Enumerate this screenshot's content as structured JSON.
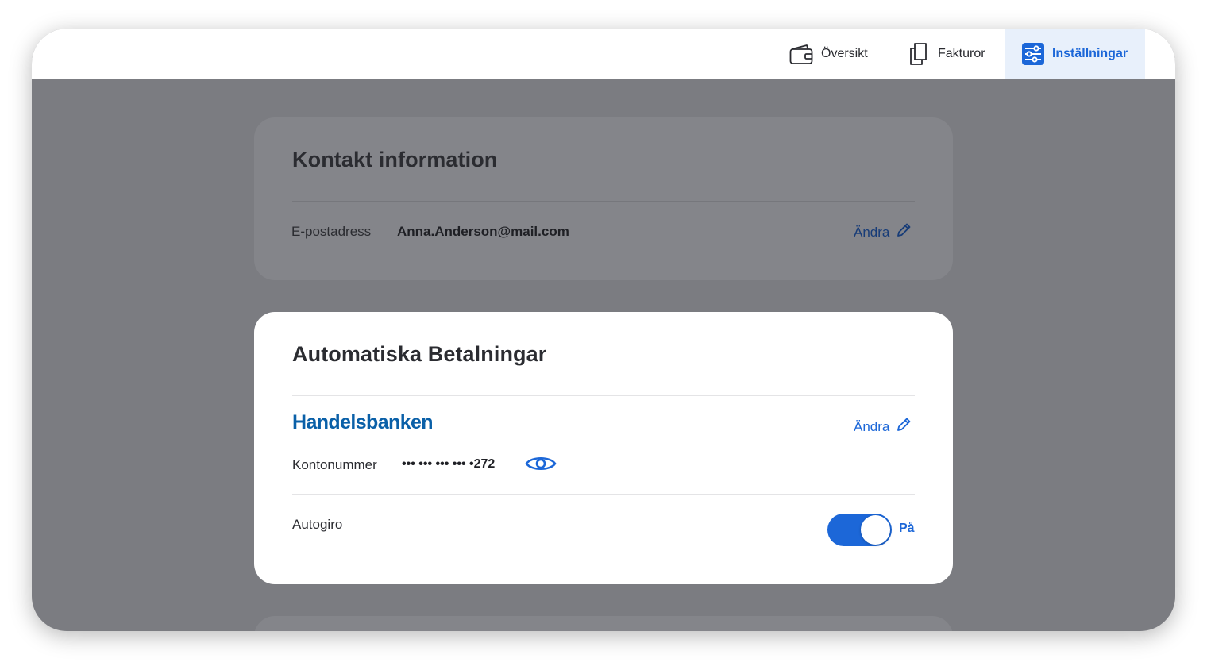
{
  "nav": {
    "overview_label": "Översikt",
    "invoices_label": "Fakturor",
    "settings_label": "Inställningar",
    "active": "settings"
  },
  "contact": {
    "title": "Kontakt information",
    "email_label": "E-postadress",
    "email_value": "Anna.Anderson@mail.com",
    "edit_label": "Ändra"
  },
  "autopay": {
    "title": "Automatiska Betalningar",
    "bank_name": "Handelsbanken",
    "edit_label": "Ändra",
    "account_label": "Kontonummer",
    "account_masked": "••• ••• ••• ••• •272",
    "autogiro_label": "Autogiro",
    "autogiro_state": "På",
    "autogiro_on": true
  },
  "colors": {
    "accent": "#1c67d8",
    "overlay": "#7b7c81",
    "bank_brand": "#0a60a8"
  },
  "icons": [
    "wallet-icon",
    "documents-icon",
    "sliders-icon",
    "pencil-icon",
    "eye-icon"
  ]
}
